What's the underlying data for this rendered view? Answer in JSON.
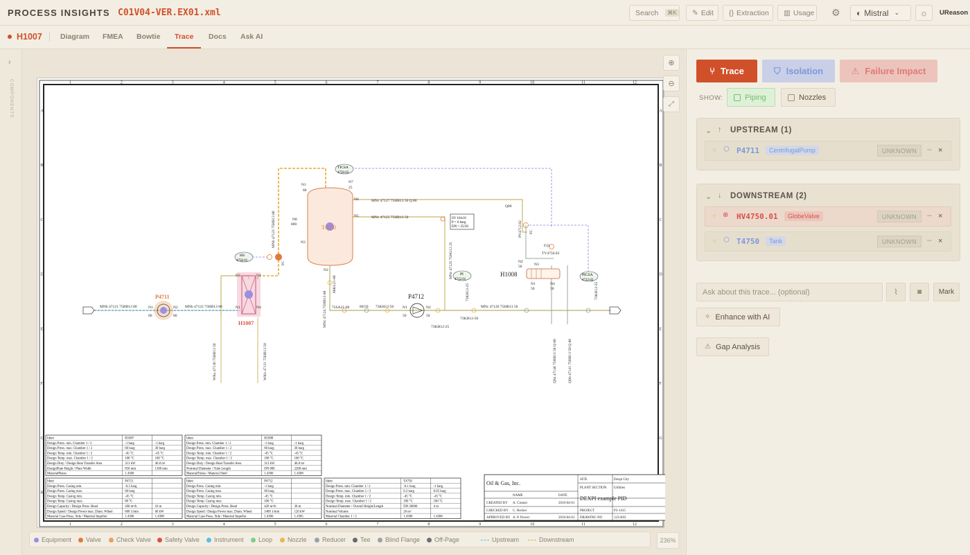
{
  "header": {
    "brand": "PROCESS INSIGHTS",
    "filename": "C01V04-VER.EX01.xml",
    "search_label": "Search",
    "search_shortcut": "⌘K",
    "edit_label": "Edit",
    "extraction_label": "Extraction",
    "usage_label": "Usage",
    "model_label": "Mistral",
    "user_label": "UReason"
  },
  "subheader": {
    "tag": "H1007",
    "tabs": [
      "Diagram",
      "FMEA",
      "Bowtie",
      "Trace",
      "Docs",
      "Ask AI"
    ],
    "active_tab": "Trace"
  },
  "sidebar": {
    "label": "COMPONENTS"
  },
  "drawing": {
    "col_numbers": [
      "1",
      "2",
      "3",
      "4",
      "5",
      "6",
      "7",
      "8",
      "9",
      "10",
      "11",
      "12"
    ],
    "row_letters": [
      "A",
      "B",
      "C",
      "D",
      "E",
      "F",
      "G",
      "H"
    ],
    "tags": {
      "p4711": "P4711",
      "h1007": "H1007",
      "t4750": "T4750",
      "p4712": "P4712",
      "h1008": "H1008",
      "ticsa": "TICSA",
      "ticsa_no": "4750.03",
      "hs": "HS",
      "hs_no": "4750.01",
      "pi": "PI",
      "pi_no": "4712.01",
      "picsa": "PICSA",
      "picsa_no": "4712.02",
      "sv": "SV 104.01",
      "sv_p": "P = 6 barg",
      "sv_dn": "DN = 25/50",
      "fo": "F.O.",
      "tv": "TV4750.03",
      "pv": "PV4712.02",
      "fc1": "FC",
      "fc2": "FC"
    },
    "lines": {
      "l1": "MNb 47121 75HB13 80",
      "l2": "MNb 47122 75HB13 80",
      "l3": "MNb 47123 75HB13 80",
      "l4": "MNc 47127 75HB13 50 Q 80",
      "l5": "MNc 47125 75HB13 50",
      "l6": "MNc 47124 75HB13 80",
      "l7": "MNc 47126 75HB13 50",
      "l8": "MNc 47125 75HG12 25",
      "l9": "WKa 47130 75HB13 50",
      "l10": "WKb 47131 75HB13 50",
      "l11": "QSa 47140 75HB13 50 Q 80",
      "l12": "QSb 47141 75HB13 50 Q 80",
      "r1": "75SA21-80",
      "r2": "80/50",
      "r3": "73KH12-50",
      "r4": "73KH12-50",
      "r5": "73KH12-25",
      "r6": "73KH12-25",
      "r7": "73KH12-25",
      "r8": "66KL21-80",
      "q80": "Q80"
    },
    "nozzles": {
      "n1": "N1",
      "n2": "N2",
      "n3": "N3",
      "n4": "N4",
      "n5": "N5",
      "n6": "N6",
      "n7": "N7",
      "n8": "N8",
      "v80": "80",
      "v50": "50",
      "v25": "25",
      "v800": "800"
    },
    "titleblock": {
      "company": "Oil & Gas, Inc.",
      "site_label": "SITE",
      "site": "Dexpi City",
      "plant_label": "PLANT SECTION",
      "plant": "Utilities",
      "name_label": "NAME",
      "date_label": "DATE",
      "title": "DEXPI example PID",
      "created_label": "CREATED BY",
      "created": "A. Creator",
      "created_date": "2016-04-01",
      "checked_label": "CHECKED BY",
      "checked": "C. Hecker",
      "project_label": "PROJECT",
      "project": "P3-1415",
      "approved_label": "APPROVED BY",
      "approved": "A. P. Prover",
      "approved_date": "2016-04-01",
      "drawing_label": "DRAWING NO",
      "drawing": "123/A93"
    },
    "tables": {
      "h1007": {
        "head": [
          "Ident",
          "H1007",
          ""
        ],
        "rows": [
          [
            "Design Press. min. Chamber 1 / 2",
            "-1 barg",
            "-1 barg"
          ],
          [
            "Design Press. max. Chamber 1 / 2",
            "60 barg",
            "30 barg"
          ],
          [
            "Design Temp. min. Chamber 1 / 2",
            "-45 °C",
            "-45 °C"
          ],
          [
            "Design Temp. max. Chamber 1 / 2",
            "100 °C",
            "100 °C"
          ],
          [
            "Design Duty / Design Heat Transfer Area",
            "313 kW",
            "46.8 m²"
          ],
          [
            "DesignPlate Height / Plate Width",
            "850 mm",
            "1100 mm"
          ],
          [
            "MaterialPlates",
            "1.4306",
            ""
          ]
        ]
      },
      "h1008": {
        "head": [
          "Ident",
          "H1008",
          ""
        ],
        "rows": [
          [
            "Design Press. min. Chamber 1 / 2",
            "-1 barg",
            "-1 barg"
          ],
          [
            "Design Press. max. Chamber 1 / 2",
            "60 barg",
            "30 barg"
          ],
          [
            "Design Temp. min. Chamber 1 / 2",
            "-45 °C",
            "-45 °C"
          ],
          [
            "Design Temp. max. Chamber 1 / 2",
            "100 °C",
            "100 °C"
          ],
          [
            "Design Duty / Design Heat Transfer Area",
            "313 kW",
            "46.8 m²"
          ],
          [
            "Nominal Diameter / Tube Length",
            "DN 800",
            "2200 mm"
          ],
          [
            "MaterialTubes / Material Shell",
            "1.4306",
            "1.4308"
          ]
        ]
      },
      "p4711": {
        "head": [
          "Ident",
          "P4711",
          ""
        ],
        "rows": [
          [
            "Design Press. Casing min.",
            "-0.5 barg",
            ""
          ],
          [
            "Design Press. Casing max.",
            "60 barg",
            ""
          ],
          [
            "Design Temp. Casing min.",
            "-45 °C",
            ""
          ],
          [
            "Design Temp. Casing max.",
            "80 °C",
            ""
          ],
          [
            "Design Capacity / Design Press. Head",
            "200 m³/h",
            "10 m"
          ],
          [
            "Design Speed / Design Power max. Diam. Wheel",
            "600 1/min",
            "60 kW"
          ],
          [
            "Material Case Press. Side / Material Impeller",
            "1.4306",
            "1.4308"
          ]
        ]
      },
      "p4712": {
        "head": [
          "Ident",
          "P4712",
          ""
        ],
        "rows": [
          [
            "Design Press. Casing min.",
            "-1 barg",
            ""
          ],
          [
            "Design Press. Casing max.",
            "60 barg",
            ""
          ],
          [
            "Design Temp. Casing min.",
            "-45 °C",
            ""
          ],
          [
            "Design Temp. Casing max.",
            "100 °C",
            ""
          ],
          [
            "Design Capacity / Design Press. Head",
            "420 m³/h",
            "30 m"
          ],
          [
            "Design Speed / Design Power max. Diam. Wheel",
            "1400 1/min",
            "120 kW"
          ],
          [
            "Material Case Press. Side / Material Impeller",
            "1.4306",
            "1.4305"
          ]
        ]
      },
      "t4750": {
        "head": [
          "Ident",
          "T4750",
          ""
        ],
        "rows": [
          [
            "Design Press. min. Chamber 1 / 2",
            "-0.1 barg",
            "-1 barg"
          ],
          [
            "Design Press. max. Chamber 1 / 2",
            "0.3 barg",
            "0.05 barg"
          ],
          [
            "Design Temp. min. Chamber 1 / 2",
            "-45 °C",
            "-45 °C"
          ],
          [
            "Design Temp. max. Chamber 1 / 2",
            "100 °C",
            "100 °C"
          ],
          [
            "Nominal Diameter / Overall Height/Length",
            "DN 20000",
            "4 m"
          ],
          [
            "Nominal Volume",
            "26 m³",
            ""
          ],
          [
            "Material Chamber 1 / 2",
            "1.4306",
            "1.4306"
          ]
        ]
      }
    }
  },
  "legend": {
    "items": [
      {
        "label": "Equipment",
        "color": "#9b8fe0"
      },
      {
        "label": "Valve",
        "color": "#e07a3a"
      },
      {
        "label": "Check Valve",
        "color": "#e8a060"
      },
      {
        "label": "Safety Valve",
        "color": "#d9504a"
      },
      {
        "label": "Instrument",
        "color": "#5bbfe0"
      },
      {
        "label": "Loop",
        "color": "#7fcf8a"
      },
      {
        "label": "Nozzle",
        "color": "#e8b84a"
      },
      {
        "label": "Reducer",
        "color": "#9aa0b0"
      },
      {
        "label": "Tee",
        "color": "#6a6a6a"
      },
      {
        "label": "Blind Flange",
        "color": "#a0a0a0"
      },
      {
        "label": "Off-Page",
        "color": "#707070"
      }
    ],
    "upstream_label": "Upstream",
    "downstream_label": "Downstream",
    "zoom": "236%"
  },
  "panel": {
    "modes": {
      "trace": "Trace",
      "isolation": "Isolation",
      "failure": "Failure Impact"
    },
    "show_label": "SHOW:",
    "piping_label": "Piping",
    "nozzles_label": "Nozzles",
    "upstream": {
      "title": "UPSTREAM (1)",
      "items": [
        {
          "tag": "P4711",
          "type": "CentrifugalPump",
          "status": "UNKNOWN",
          "extra": "--"
        }
      ]
    },
    "downstream": {
      "title": "DOWNSTREAM (2)",
      "items": [
        {
          "tag": "HV4750.01",
          "type": "GlobeValve",
          "status": "UNKNOWN",
          "extra": "--"
        },
        {
          "tag": "T4750",
          "type": "Tank",
          "status": "UNKNOWN",
          "extra": "--"
        }
      ]
    },
    "ask_placeholder": "Ask about this trace... (optional)",
    "mark_label": "Mark",
    "enhance_label": "Enhance with AI",
    "gap_label": "Gap Analysis"
  }
}
